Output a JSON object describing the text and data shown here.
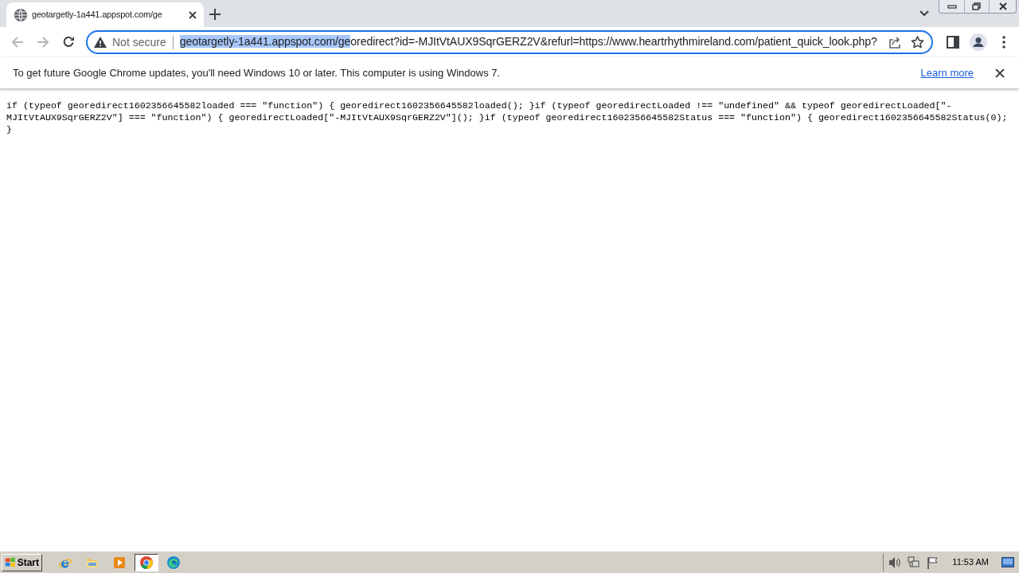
{
  "window_controls": [
    {
      "kind": "minimize"
    },
    {
      "kind": "restore"
    },
    {
      "kind": "close"
    }
  ],
  "tabs": [
    {
      "title": "geotargetly-1a441.appspot.com/ge",
      "selected": true
    }
  ],
  "nav_buttons": [
    {
      "kind": "back",
      "disabled": true
    },
    {
      "kind": "forward",
      "disabled": true
    },
    {
      "kind": "reload",
      "disabled": false
    }
  ],
  "address_bar": {
    "security": "Not secure",
    "url_selected": "geotargetly-1a441.appspot.com/ge",
    "url_rest": "oredirect?id=-MJItVtAUX9SqrGERZ2V&refurl=https://www.heartrhythmireland.com/patient_quick_look.php?"
  },
  "info_bar": {
    "message": "To get future Google Chrome updates, you'll need Windows 10 or later. This computer is using Windows 7.",
    "link": "Learn more"
  },
  "page": {
    "lines": [
      "if (typeof georedirect1602356645582loaded === \"function\") { georedirect1602356645582loaded(); }if (typeof georedirectLoaded !== \"undefined\" && typeof georedirectLoaded[\"-",
      "MJItVtAUX9SqrGERZ2V\"] === \"function\") { georedirectLoaded[\"-MJItVtAUX9SqrGERZ2V\"](); }if (typeof georedirect1602356645582Status === \"function\") { georedirect1602356645582Status(0);",
      "}"
    ]
  },
  "taskbar": {
    "start": "Start",
    "apps": [
      {
        "kind": "ie",
        "selected": false
      },
      {
        "kind": "folder",
        "selected": false
      },
      {
        "kind": "media",
        "selected": false
      },
      {
        "kind": "chrome",
        "selected": true
      },
      {
        "kind": "edge",
        "selected": false
      }
    ],
    "tray": [
      {
        "kind": "speaker"
      },
      {
        "kind": "network"
      },
      {
        "kind": "flag"
      }
    ],
    "clock": "11:53 AM"
  }
}
